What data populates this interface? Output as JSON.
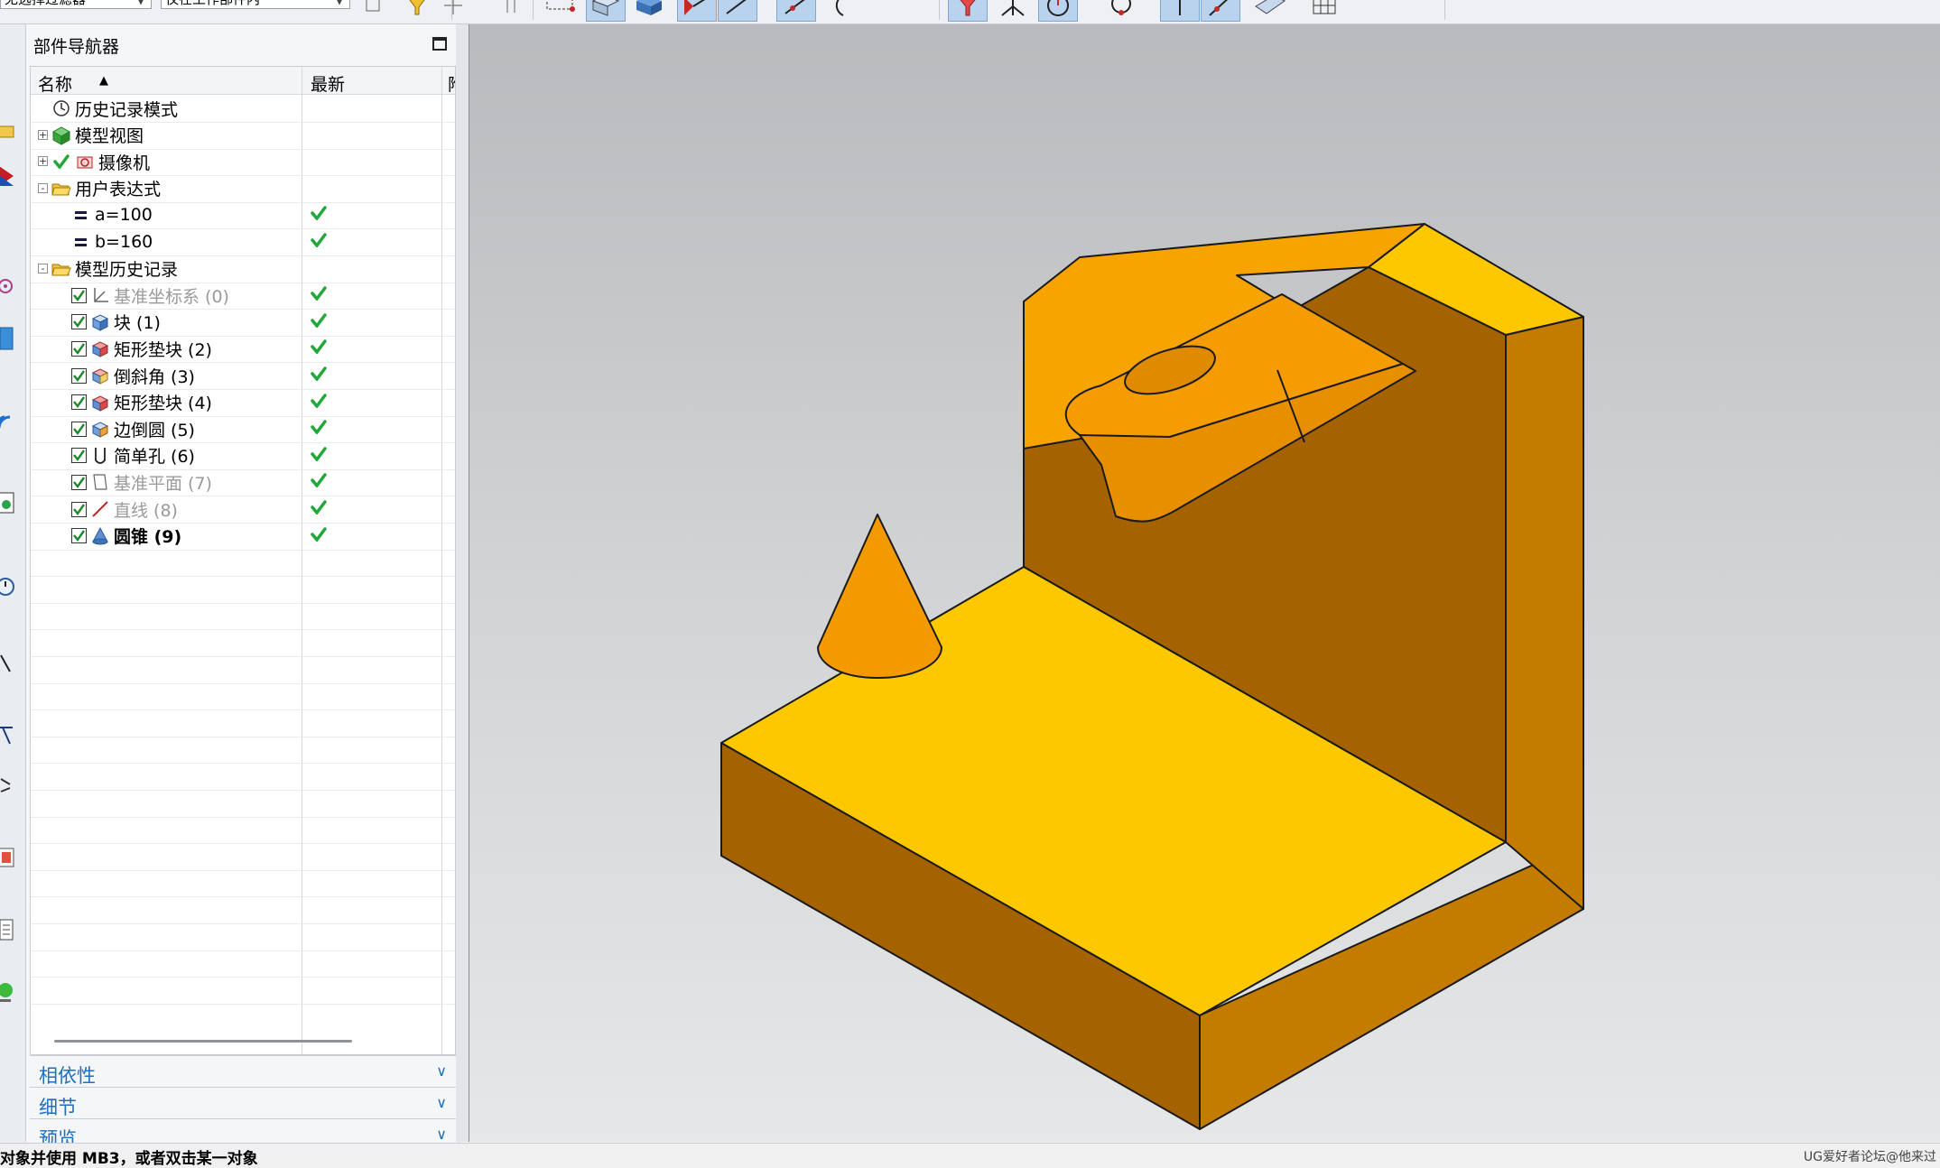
{
  "toolbar": {
    "select1_value": "无选择过滤器",
    "select2_value": "仅在工作部件内",
    "buttons": [
      {
        "name": "snap-point-icon"
      },
      {
        "name": "funnel-filter-icon"
      },
      {
        "name": "crosshair-icon"
      },
      {
        "name": "dimension-icon"
      },
      {
        "name": "rectangle-select-icon"
      },
      {
        "name": "shaded-edges-icon",
        "active": true
      },
      {
        "name": "shaded-solid-icon"
      },
      {
        "name": "view-point-icon",
        "active": true
      },
      {
        "name": "line-icon",
        "active": true
      },
      {
        "name": "arrow-line-icon",
        "active": true
      },
      {
        "name": "arc-icon"
      },
      {
        "name": "funnel-active-icon",
        "active": true
      },
      {
        "name": "angle-icon"
      },
      {
        "name": "circle-center-icon",
        "active": true
      },
      {
        "name": "circle-point-icon"
      },
      {
        "name": "vertical-line-icon",
        "active": true
      },
      {
        "name": "point-on-line-icon",
        "active": true
      },
      {
        "name": "plane-icon"
      },
      {
        "name": "grid-icon"
      }
    ]
  },
  "navigator": {
    "title": "部件导航器",
    "columns": {
      "name": "名称",
      "latest": "最新",
      "third": "附"
    },
    "rows": [
      {
        "indent": 0,
        "expander": "",
        "icon": "clock-icon",
        "label": "历史记录模式",
        "check": false,
        "latest": false,
        "style": ""
      },
      {
        "indent": 0,
        "expander": "+",
        "icon": "model-views-icon",
        "label": "模型视图",
        "check": false,
        "latest": false,
        "style": ""
      },
      {
        "indent": 0,
        "expander": "+",
        "icon": "camera-icon",
        "label": "摄像机",
        "check": false,
        "tick": true,
        "latest": false,
        "style": ""
      },
      {
        "indent": 0,
        "expander": "-",
        "icon": "folder-open-icon",
        "label": "用户表达式",
        "check": false,
        "latest": false,
        "style": ""
      },
      {
        "indent": 1,
        "expander": "",
        "icon": "equals-icon",
        "label": "a=100",
        "check": false,
        "latest": true,
        "style": ""
      },
      {
        "indent": 1,
        "expander": "",
        "icon": "equals-icon",
        "label": "b=160",
        "check": false,
        "latest": true,
        "style": ""
      },
      {
        "indent": 0,
        "expander": "-",
        "icon": "folder-open-icon",
        "label": "模型历史记录",
        "check": false,
        "latest": false,
        "style": ""
      },
      {
        "indent": 1,
        "expander": "",
        "icon": "datum-csys-icon",
        "label": "基准坐标系 (0)",
        "check": true,
        "latest": true,
        "style": "dim"
      },
      {
        "indent": 1,
        "expander": "",
        "icon": "block-icon",
        "label": "块 (1)",
        "check": true,
        "latest": true,
        "style": ""
      },
      {
        "indent": 1,
        "expander": "",
        "icon": "pad-icon",
        "label": "矩形垫块 (2)",
        "check": true,
        "latest": true,
        "style": ""
      },
      {
        "indent": 1,
        "expander": "",
        "icon": "chamfer-icon",
        "label": "倒斜角 (3)",
        "check": true,
        "latest": true,
        "style": ""
      },
      {
        "indent": 1,
        "expander": "",
        "icon": "pad-icon",
        "label": "矩形垫块 (4)",
        "check": true,
        "latest": true,
        "style": ""
      },
      {
        "indent": 1,
        "expander": "",
        "icon": "edge-blend-icon",
        "label": "边倒圆 (5)",
        "check": true,
        "latest": true,
        "style": ""
      },
      {
        "indent": 1,
        "expander": "",
        "icon": "hole-icon",
        "label": "简单孔 (6)",
        "check": true,
        "latest": true,
        "style": ""
      },
      {
        "indent": 1,
        "expander": "",
        "icon": "datum-plane-icon",
        "label": "基准平面 (7)",
        "check": true,
        "latest": true,
        "style": "dim"
      },
      {
        "indent": 1,
        "expander": "",
        "icon": "line-red-icon",
        "label": "直线 (8)",
        "check": true,
        "latest": true,
        "style": "dim"
      },
      {
        "indent": 1,
        "expander": "",
        "icon": "cone-icon",
        "label": "圆锥 (9)",
        "check": true,
        "latest": true,
        "style": "bold"
      }
    ],
    "panels": [
      "相依性",
      "细节",
      "预览"
    ]
  },
  "status": {
    "text": "对象并使用 MB3，或者双击某一对象",
    "watermark": "UG爱好者论坛@他来过"
  },
  "colors": {
    "accent_blue": "#1e6fbf",
    "check_green": "#22a83a",
    "part_top": "#fdc800",
    "part_front": "#a46300",
    "part_side": "#c47c00"
  }
}
